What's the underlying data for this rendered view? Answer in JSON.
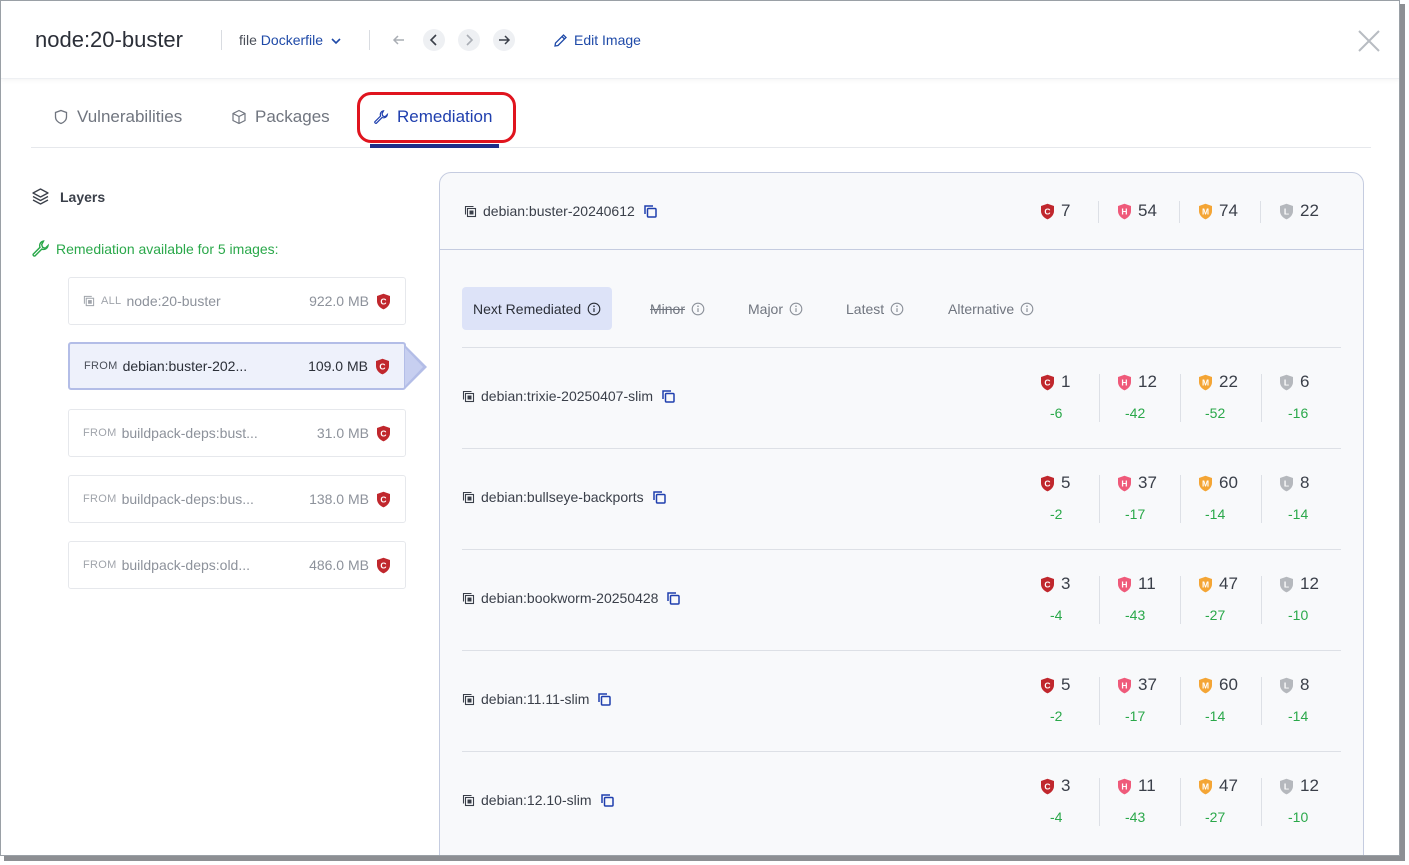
{
  "header": {
    "title": "node:20-buster",
    "file_label": "file",
    "file_value": "Dockerfile",
    "edit_label": "Edit Image"
  },
  "tabs": [
    {
      "label": "Vulnerabilities",
      "icon": "shield-icon"
    },
    {
      "label": "Packages",
      "icon": "package-icon"
    },
    {
      "label": "Remediation",
      "icon": "wrench-icon",
      "active": true
    }
  ],
  "left": {
    "layers_heading": "Layers",
    "remediation_note": "Remediation available for 5 images:",
    "layers": [
      {
        "keyword": "ALL",
        "name": "node:20-buster",
        "size": "922.0 MB",
        "severity": "C",
        "active": false,
        "cube": true
      },
      {
        "keyword": "FROM",
        "name": "debian:buster-202...",
        "size": "109.0 MB",
        "severity": "C",
        "active": true,
        "cube": false
      },
      {
        "keyword": "FROM",
        "name": "buildpack-deps:bust...",
        "size": "31.0 MB",
        "severity": "C",
        "active": false,
        "cube": false
      },
      {
        "keyword": "FROM",
        "name": "buildpack-deps:bus...",
        "size": "138.0 MB",
        "severity": "C",
        "active": false,
        "cube": false
      },
      {
        "keyword": "FROM",
        "name": "buildpack-deps:old...",
        "size": "486.0 MB",
        "severity": "C",
        "active": false,
        "cube": false
      }
    ]
  },
  "current": {
    "name": "debian:buster-20240612",
    "counts": {
      "C": "7",
      "H": "54",
      "M": "74",
      "L": "22"
    }
  },
  "subtabs": [
    {
      "label": "Next Remediated",
      "active": true,
      "strike": false
    },
    {
      "label": "Minor",
      "active": false,
      "strike": true
    },
    {
      "label": "Major",
      "active": false,
      "strike": false
    },
    {
      "label": "Latest",
      "active": false,
      "strike": false
    },
    {
      "label": "Alternative",
      "active": false,
      "strike": false
    }
  ],
  "rows": [
    {
      "name": "debian:trixie-20250407-slim",
      "C": "1",
      "H": "12",
      "M": "22",
      "L": "6",
      "dC": "-6",
      "dH": "-42",
      "dM": "-52",
      "dL": "-16"
    },
    {
      "name": "debian:bullseye-backports",
      "C": "5",
      "H": "37",
      "M": "60",
      "L": "8",
      "dC": "-2",
      "dH": "-17",
      "dM": "-14",
      "dL": "-14"
    },
    {
      "name": "debian:bookworm-20250428",
      "C": "3",
      "H": "11",
      "M": "47",
      "L": "12",
      "dC": "-4",
      "dH": "-43",
      "dM": "-27",
      "dL": "-10"
    },
    {
      "name": "debian:11.11-slim",
      "C": "5",
      "H": "37",
      "M": "60",
      "L": "8",
      "dC": "-2",
      "dH": "-17",
      "dM": "-14",
      "dL": "-14"
    },
    {
      "name": "debian:12.10-slim",
      "C": "3",
      "H": "11",
      "M": "47",
      "L": "12",
      "dC": "-4",
      "dH": "-43",
      "dM": "-27",
      "dL": "-10"
    }
  ],
  "colors": {
    "critical": "#c0272d",
    "high": "#ef5a7a",
    "medium": "#f4a535",
    "low": "#b5b8bd",
    "accent": "#1f3fae",
    "positive": "#2aa84a",
    "highlight": "#e0141e"
  }
}
